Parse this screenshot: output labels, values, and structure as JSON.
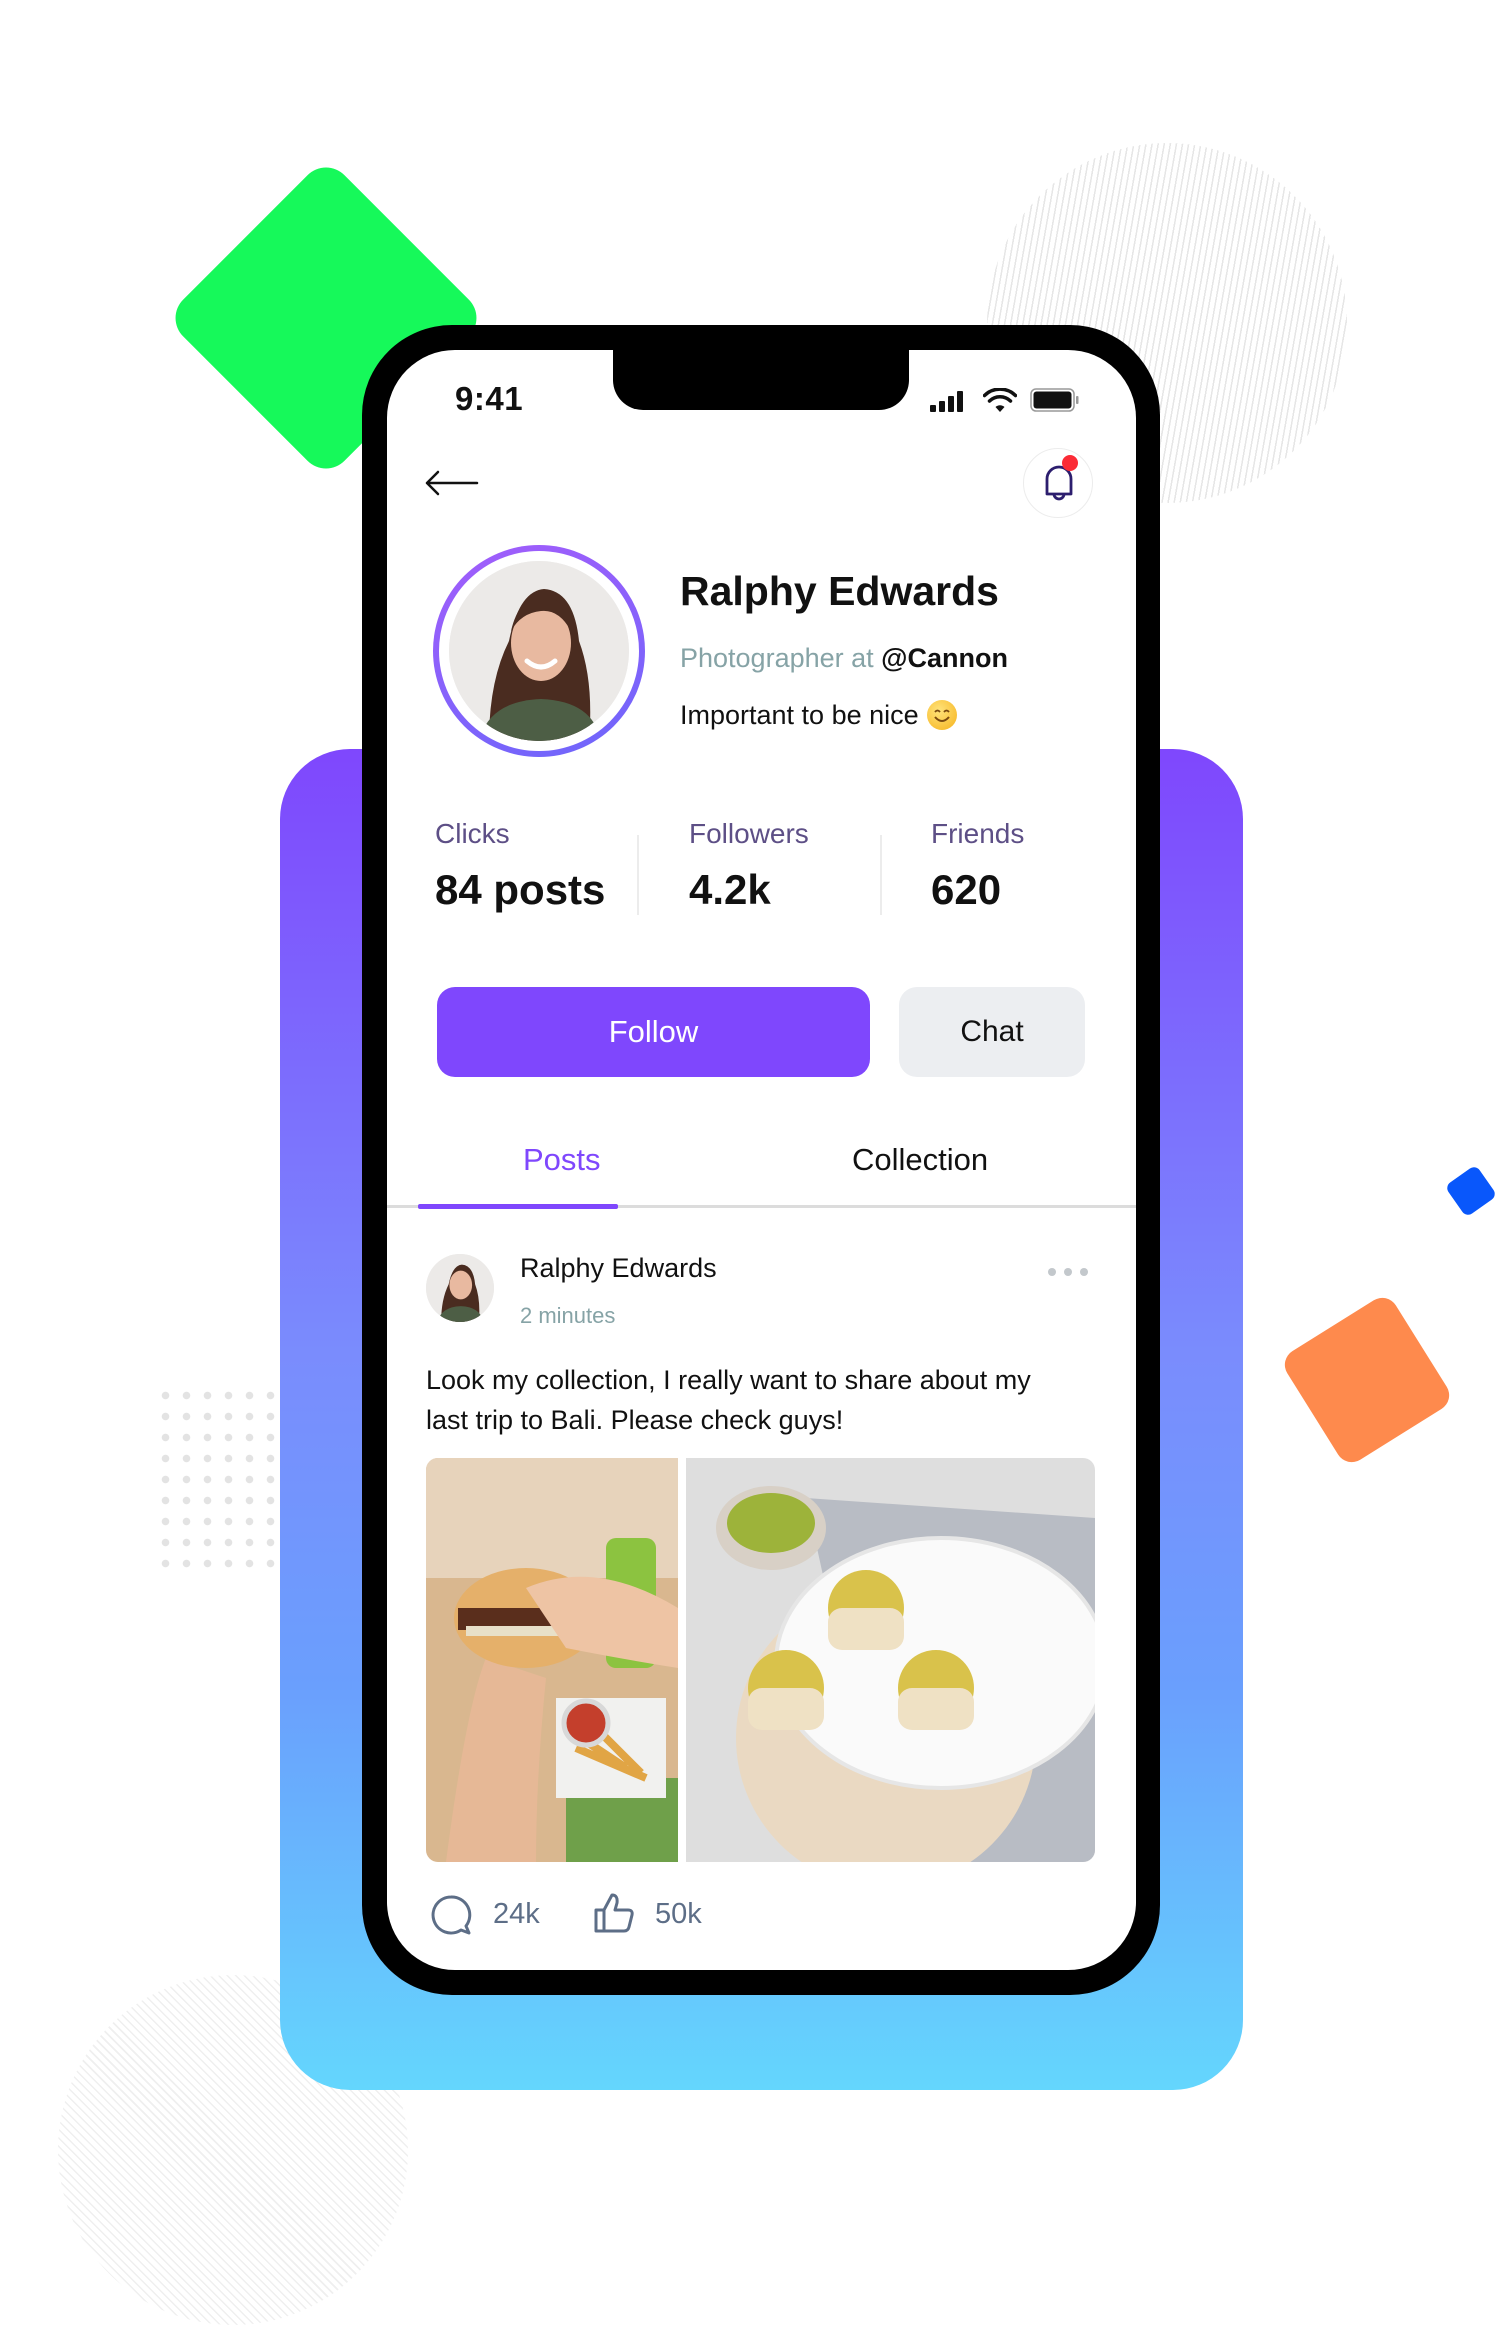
{
  "status_bar": {
    "time": "9:41"
  },
  "header": {
    "back_icon": "arrow-left-icon",
    "notification_icon": "bell-icon",
    "has_unread": true
  },
  "profile": {
    "name": "Ralphy Edwards",
    "role_prefix": "Photographer at",
    "role_company": "@Cannon",
    "bio": "Important to be nice",
    "bio_emoji": "smiling-face-emoji"
  },
  "stats": [
    {
      "label": "Clicks",
      "value": "84 posts"
    },
    {
      "label": "Followers",
      "value": "4.2k"
    },
    {
      "label": "Friends",
      "value": "620"
    }
  ],
  "actions": {
    "follow_label": "Follow",
    "chat_label": "Chat"
  },
  "tabs": [
    {
      "label": "Posts",
      "active": true
    },
    {
      "label": "Collection",
      "active": false
    }
  ],
  "post": {
    "author": "Ralphy Edwards",
    "time": "2 minutes",
    "text": "Look my collection, I really want to share about my last trip to Bali. Please check guys!",
    "images": [
      {
        "alt": "burger-and-fries-photo"
      },
      {
        "alt": "pistachio-tarts-photo"
      }
    ],
    "comments": "24k",
    "likes": "50k"
  },
  "colors": {
    "accent": "#7f47fd",
    "muted_label": "#5d4f86",
    "subtle_text": "#86a3a6",
    "notification_dot": "#fb2b36",
    "decor_green": "#16f95a",
    "decor_orange": "#fe8a4d",
    "decor_blue": "#0957fb"
  }
}
